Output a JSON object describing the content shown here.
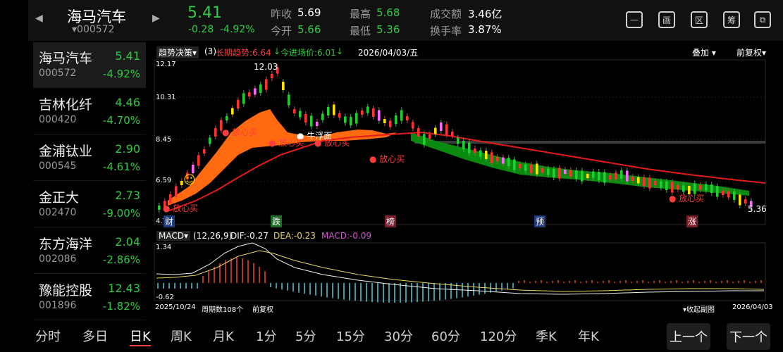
{
  "header": {
    "name": "海马汽车",
    "code": "000572",
    "price": "5.41",
    "change": "-0.28",
    "change_pct": "-4.92%",
    "labels": {
      "prev_close": "昨收",
      "open": "今开",
      "high": "最高",
      "low": "最低",
      "volume": "成交额",
      "turnover": "换手率"
    },
    "values": {
      "prev_close": "5.69",
      "open": "5.66",
      "high": "5.68",
      "low": "5.36",
      "volume": "3.46亿",
      "turnover": "3.87%"
    },
    "icons": [
      "minus-box-icon",
      "screen-icon",
      "region-icon",
      "chip-icon",
      "device-icon"
    ],
    "icon_glyphs": [
      "—",
      "画",
      "区",
      "筹",
      "⧉"
    ]
  },
  "stock_list": [
    {
      "name": "海马汽车",
      "code": "000572",
      "price": "5.41",
      "pct": "-4.92%"
    },
    {
      "name": "吉林化纤",
      "code": "000420",
      "price": "4.46",
      "pct": "-4.70%"
    },
    {
      "name": "金浦钛业",
      "code": "000545",
      "price": "2.90",
      "pct": "-4.61%"
    },
    {
      "name": "金正大",
      "code": "002470",
      "price": "2.73",
      "pct": "-9.00%"
    },
    {
      "name": "东方海洋",
      "code": "002086",
      "price": "2.04",
      "pct": "-2.86%"
    },
    {
      "name": "豫能控股",
      "code": "001896",
      "price": "12.43",
      "pct": "-1.82%"
    }
  ],
  "chart_toolbar": {
    "indicator": "趋势决策",
    "param": "(3)",
    "long_trend": "长期趋势:6.64",
    "long_trend_arrow": "↓",
    "entry_price": "今进场价:6.01",
    "entry_arrow": "↓",
    "date": "2026/04/03/五",
    "overlay": "叠加",
    "adjust": "前复权"
  },
  "price_axis": [
    "12.17",
    "10.31",
    "8.45",
    "6.59",
    "4.7"
  ],
  "annotations": {
    "high": "12.03",
    "low": "5.36",
    "buy": "放心买",
    "bull": "牛浮面",
    "smile": "☺"
  },
  "event_markers": [
    "财",
    "跌",
    "榜",
    "预",
    "涨"
  ],
  "macd_toolbar": {
    "name": "MACD",
    "param": "(12,26,9)",
    "dif": "DIF:-0.27",
    "dea": "DEA:-0.23",
    "macd": "MACD:-0.09"
  },
  "macd_axis": [
    "1.34",
    "-0.62"
  ],
  "footer": {
    "start_date": "2025/10/24",
    "period": "周期数108个",
    "adjust": "前复权",
    "collapse": "收起副图",
    "end_date": "2026/04/03"
  },
  "tabs": [
    "分时",
    "多日",
    "日K",
    "周K",
    "月K",
    "1分",
    "5分",
    "15分",
    "30分",
    "60分",
    "120分",
    "季K",
    "年K"
  ],
  "nav": {
    "prev": "上一个",
    "next": "下一个"
  },
  "colors": {
    "up": "#ff3b3b",
    "down": "#2ecc40",
    "bg": "#000000",
    "panel": "#111111"
  }
}
